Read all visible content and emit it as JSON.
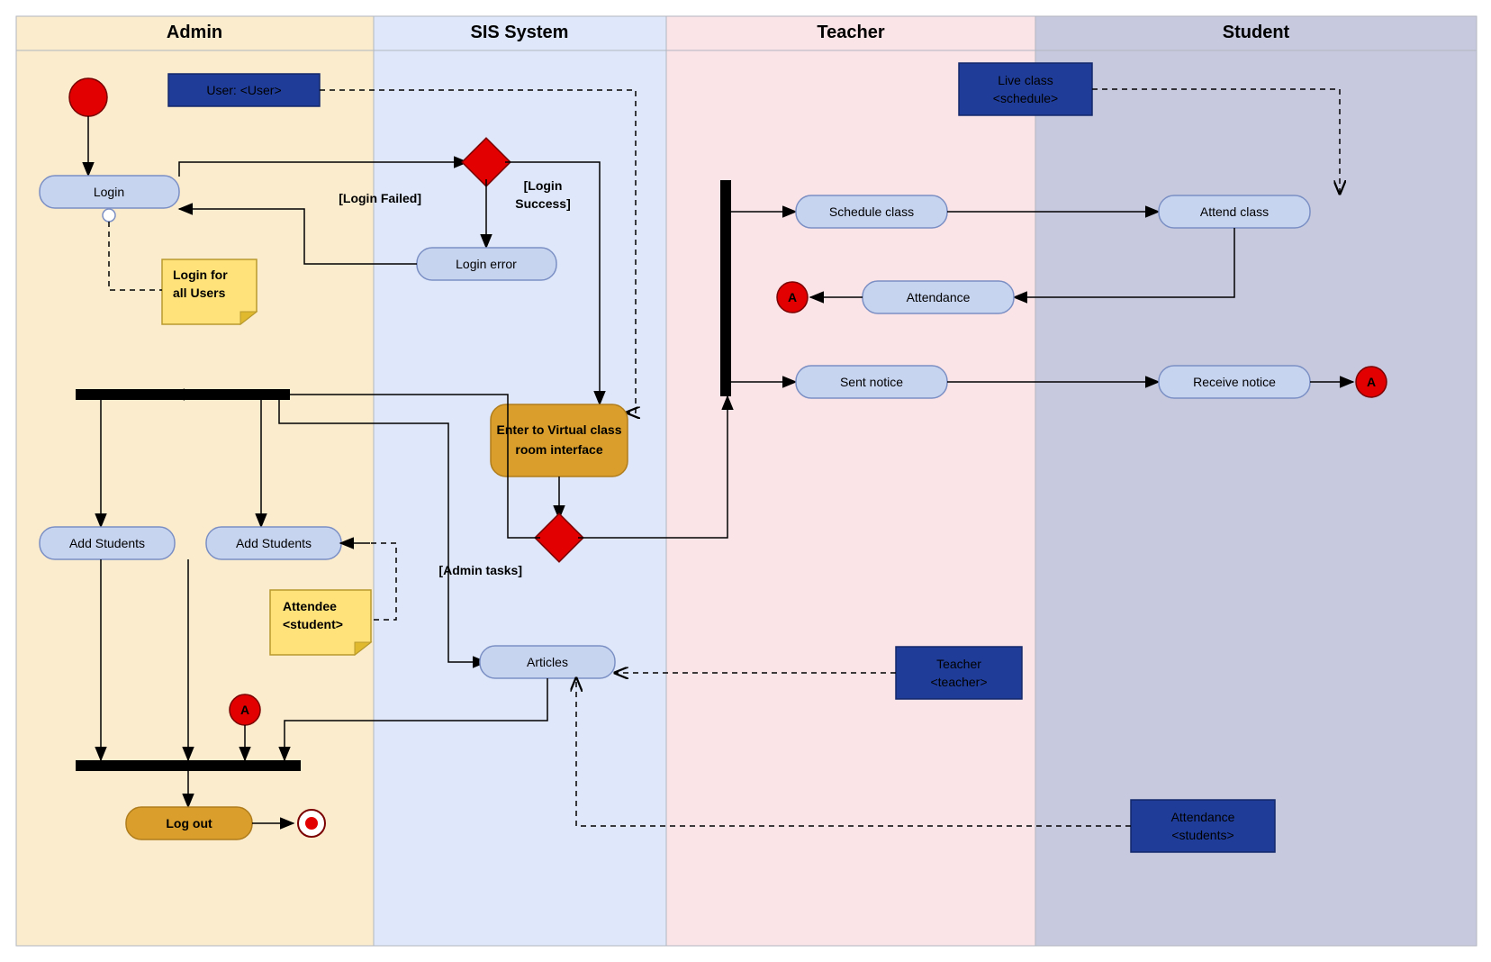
{
  "lanes": {
    "admin": "Admin",
    "sis": "SIS System",
    "teacher": "Teacher",
    "student": "Student"
  },
  "activities": {
    "login": "Login",
    "login_error": "Login error",
    "enter_vc_l1": "Enter to Virtual class",
    "enter_vc_l2": "room interface",
    "add_students_1": "Add Students",
    "add_students_2": "Add Students",
    "articles": "Articles",
    "log_out": "Log out",
    "schedule_class": "Schedule class",
    "attend_class": "Attend class",
    "attendance": "Attendance",
    "sent_notice": "Sent notice",
    "receive_notice": "Receive notice"
  },
  "guards": {
    "login_failed": "[Login Failed]",
    "login_success_l1": "[Login",
    "login_success_l2": "Success]",
    "admin_tasks": "[Admin tasks]"
  },
  "objects": {
    "user": "User: <User>",
    "live_class_l1": "Live class",
    "live_class_l2": "<schedule>",
    "teacher_l1": "Teacher",
    "teacher_l2": "<teacher>",
    "attendance_l1": "Attendance",
    "attendance_l2": "<students>"
  },
  "notes": {
    "login_all_l1": "Login for",
    "login_all_l2": "all Users",
    "attendee_l1": "Attendee",
    "attendee_l2": "<student>"
  },
  "connectors": {
    "a": "A"
  },
  "colors": {
    "admin": "#fbecce",
    "sis": "#dfe8fa",
    "teacher": "#fbe4e7",
    "student": "#c7cade",
    "lane_border": "#b0b6c0",
    "activity_fill": "#c7d4f0",
    "activity_gold": "#d99e2b",
    "object_node": "#1f3c99",
    "note_fill": "#ffe27a",
    "red": "#e20000"
  }
}
